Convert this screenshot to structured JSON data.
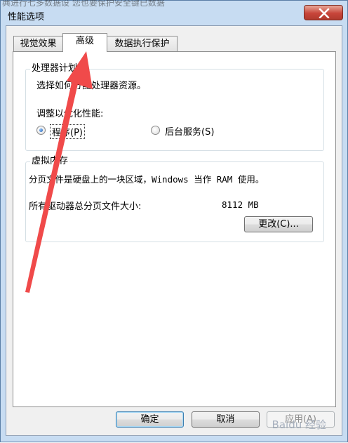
{
  "background": {
    "text": "典进行七多数据设   您也要保护安全键已数据"
  },
  "window": {
    "title": "性能选项"
  },
  "tabs": [
    {
      "label": "视觉效果"
    },
    {
      "label": "高级"
    },
    {
      "label": "数据执行保护"
    }
  ],
  "processor_group": {
    "label": "处理器计划",
    "description": "选择如何分配处理器资源。",
    "adjust_label": "调整以优化性能:",
    "options": [
      {
        "label": "程序(P)",
        "checked": true
      },
      {
        "label": "后台服务(S)",
        "checked": false
      }
    ]
  },
  "memory_group": {
    "label": "虚拟内存",
    "description": "分页文件是硬盘上的一块区域，Windows 当作 RAM 使用。",
    "total_label": "所有驱动器总分页文件大小:",
    "total_value": "8112 MB",
    "change_button": "更改(C)..."
  },
  "footer": {
    "ok": "确定",
    "cancel": "取消",
    "apply": "应用(A)"
  },
  "colors": {
    "annotation_arrow": "#f04a4a",
    "frame": "#c7dcf2"
  },
  "watermark_text": "Baidu 经验"
}
